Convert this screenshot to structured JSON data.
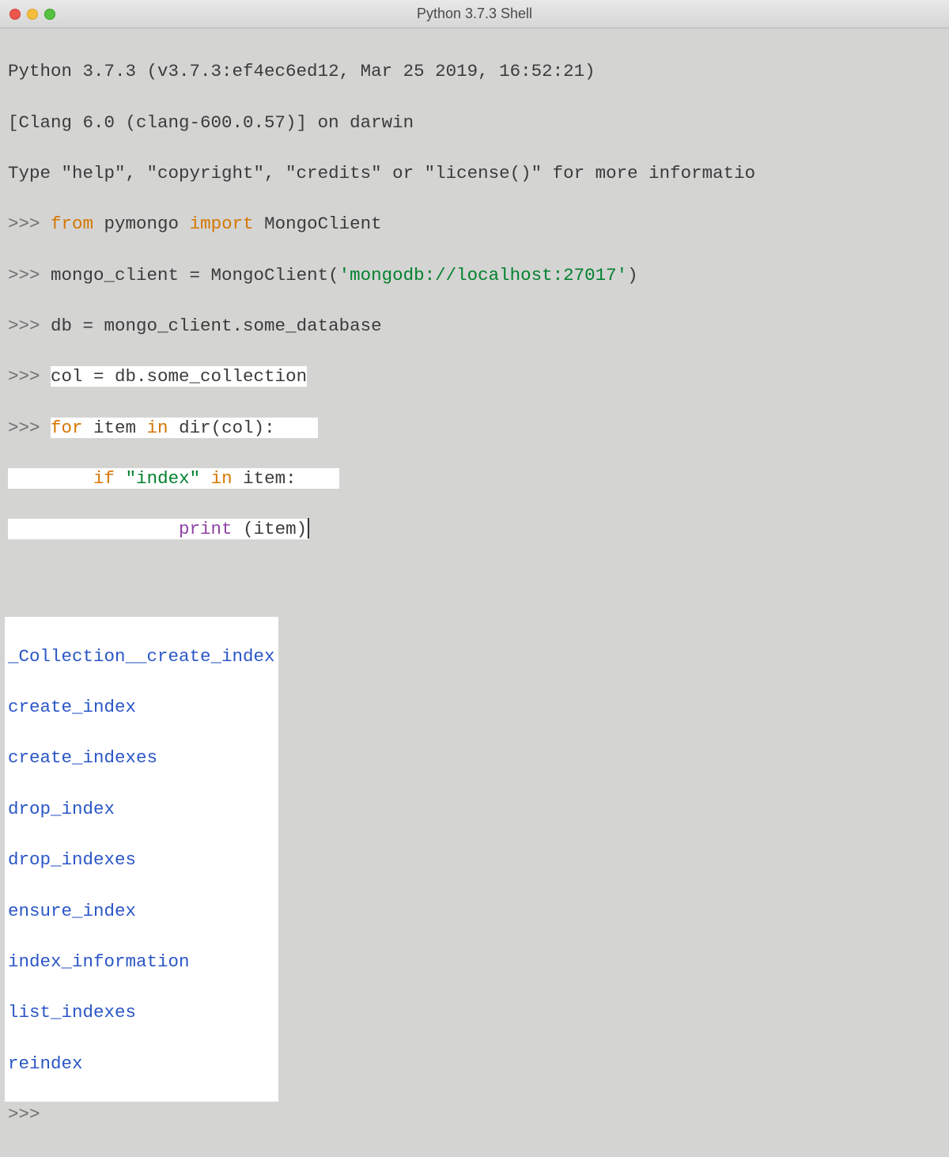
{
  "window": {
    "title": "Python 3.7.3 Shell"
  },
  "shell": {
    "banner1": "Python 3.7.3 (v3.7.3:ef4ec6ed12, Mar 25 2019, 16:52:21)",
    "banner2": "[Clang 6.0 (clang-600.0.57)] on darwin",
    "banner3_a": "Type \"help\", \"copyright\", \"credits\" or \"license()\" for more informatio",
    "prompt": ">>> ",
    "kw_from": "from",
    "line1_a": " pymongo ",
    "kw_import": "import",
    "line1_b": " MongoClient",
    "line2_a": "mongo_client = MongoClient(",
    "line2_str": "'mongodb://localhost:27017'",
    "line2_b": ")",
    "line3": "db = mongo_client.some_database",
    "line4": "col = db.some_collection",
    "kw_for": "for",
    "line5_a": " item ",
    "kw_in": "in",
    "line5_b": " dir(col):",
    "line6_a": "        ",
    "kw_if": "if",
    "line6_b": " ",
    "line6_str": "\"index\"",
    "line6_c": " ",
    "line6_d": " item:",
    "line7_a": "                ",
    "kw_print": "print",
    "line7_b": " (item)",
    "output": [
      "_Collection__create_index",
      "create_index",
      "create_indexes",
      "drop_index",
      "drop_indexes",
      "ensure_index",
      "index_information",
      "list_indexes",
      "reindex"
    ]
  }
}
